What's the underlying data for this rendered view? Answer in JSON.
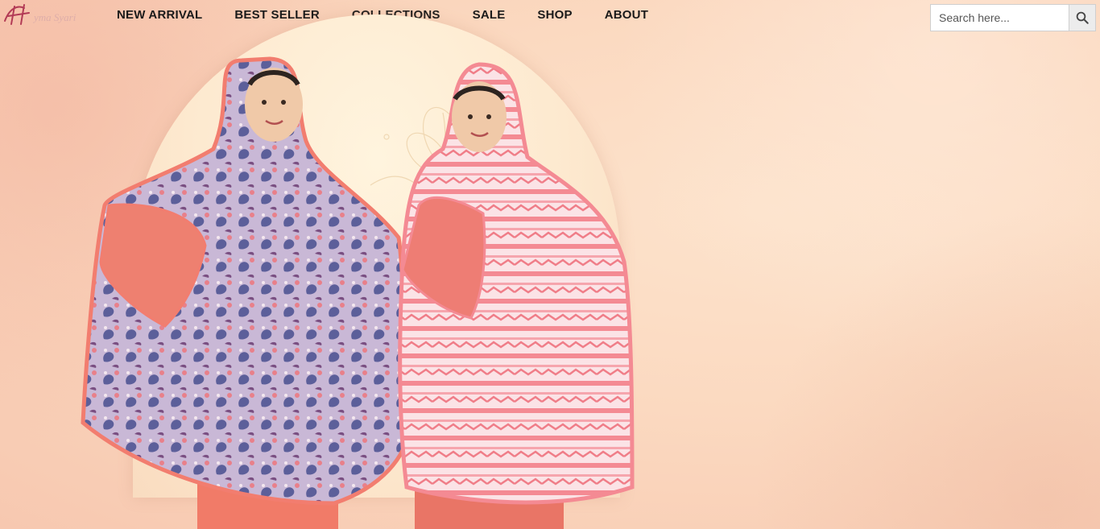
{
  "header": {
    "logo_text": "Hyma Syari",
    "nav": [
      {
        "label": "NEW ARRIVAL"
      },
      {
        "label": "BEST SELLER"
      },
      {
        "label": "COLLECTIONS"
      },
      {
        "label": "SALE"
      },
      {
        "label": "SHOP"
      },
      {
        "label": "ABOUT"
      }
    ],
    "search": {
      "placeholder": "Search here...",
      "value": ""
    }
  },
  "hero": {
    "image": "two-models-wearing-mukena-prayer-sets"
  },
  "colors": {
    "background": "#fbd9c0",
    "text": "#1a1a1a",
    "accent_coral": "#ef7d6a",
    "accent_pink": "#f48a93",
    "paisley_blue": "#5c5f9a"
  }
}
